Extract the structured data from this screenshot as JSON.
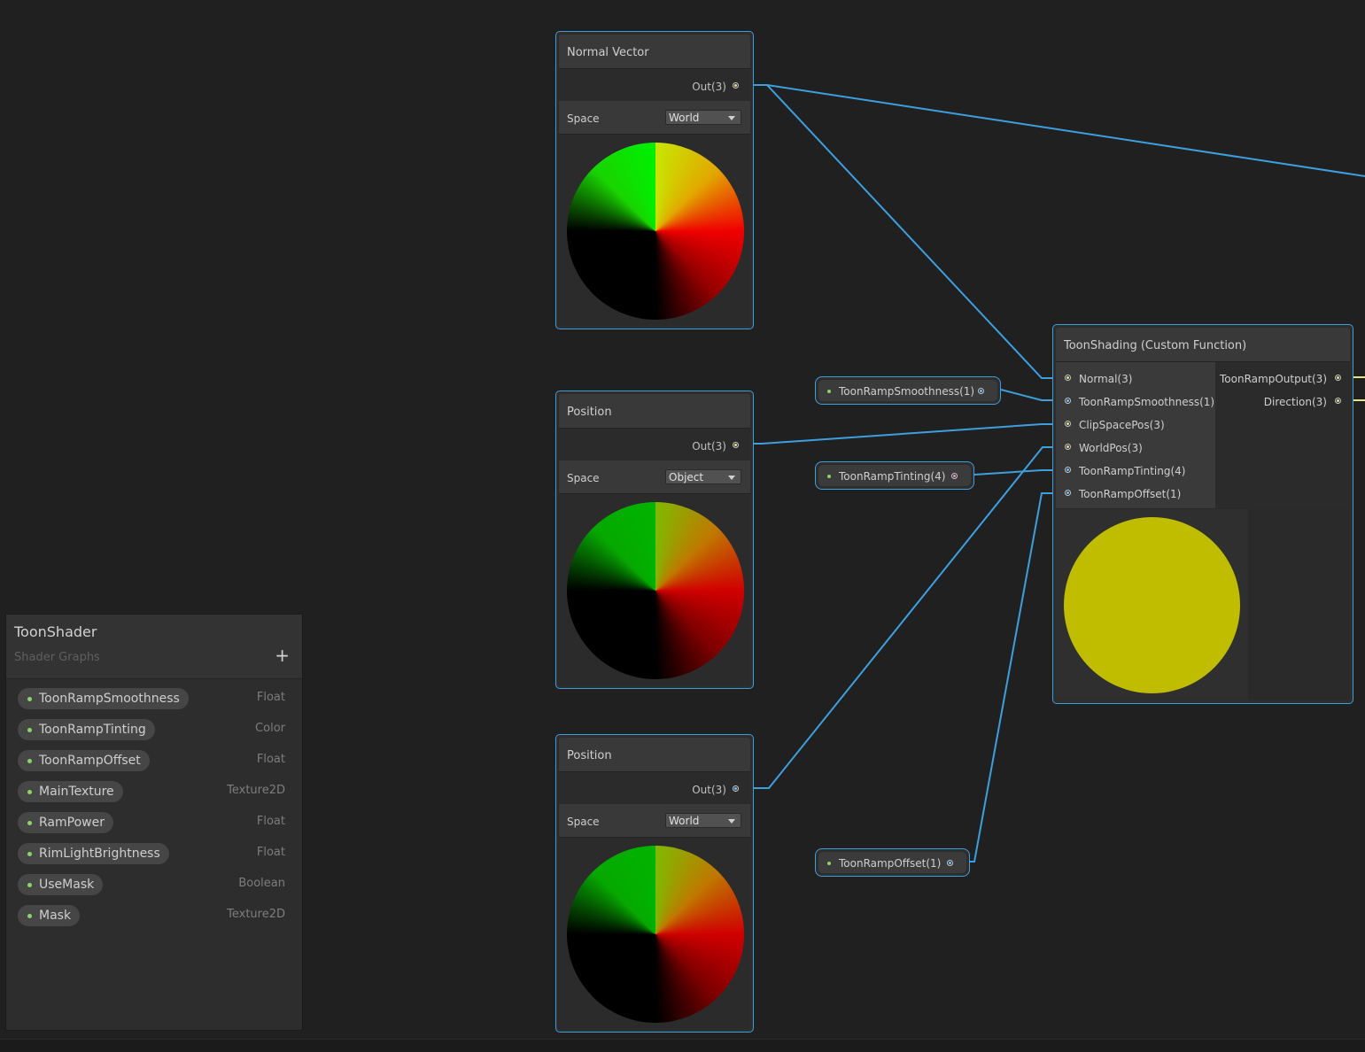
{
  "blackboard": {
    "title": "ToonShader",
    "subtitle": "Shader Graphs",
    "add_label": "+",
    "properties": [
      {
        "name": "ToonRampSmoothness",
        "type": "Float"
      },
      {
        "name": "ToonRampTinting",
        "type": "Color"
      },
      {
        "name": "ToonRampOffset",
        "type": "Float"
      },
      {
        "name": "MainTexture",
        "type": "Texture2D"
      },
      {
        "name": "RamPower",
        "type": "Float"
      },
      {
        "name": "RimLightBrightness",
        "type": "Float"
      },
      {
        "name": "UseMask",
        "type": "Boolean"
      },
      {
        "name": "Mask",
        "type": "Texture2D"
      }
    ]
  },
  "nodes": {
    "normal_vector": {
      "title": "Normal Vector",
      "out": "Out(3)",
      "control_label": "Space",
      "control_value": "World"
    },
    "position_object": {
      "title": "Position",
      "out": "Out(3)",
      "control_label": "Space",
      "control_value": "Object"
    },
    "position_world": {
      "title": "Position",
      "out": "Out(3)",
      "control_label": "Space",
      "control_value": "World"
    }
  },
  "property_nodes": {
    "smoothness": "ToonRampSmoothness(1)",
    "tinting": "ToonRampTinting(4)",
    "offset": "ToonRampOffset(1)"
  },
  "custom_function": {
    "title": "ToonShading (Custom Function)",
    "inputs": [
      "Normal(3)",
      "ToonRampSmoothness(1)",
      "ClipSpacePos(3)",
      "WorldPos(3)",
      "ToonRampTinting(4)",
      "ToonRampOffset(1)"
    ],
    "outputs": [
      "ToonRampOutput(3)",
      "Direction(3)"
    ]
  },
  "colors": {
    "wire": "#3e9fde",
    "wire_output": "#e8e28a",
    "node_border": "#3e9fde",
    "preview_yellow": "#c0bc00",
    "background": "#202020"
  }
}
